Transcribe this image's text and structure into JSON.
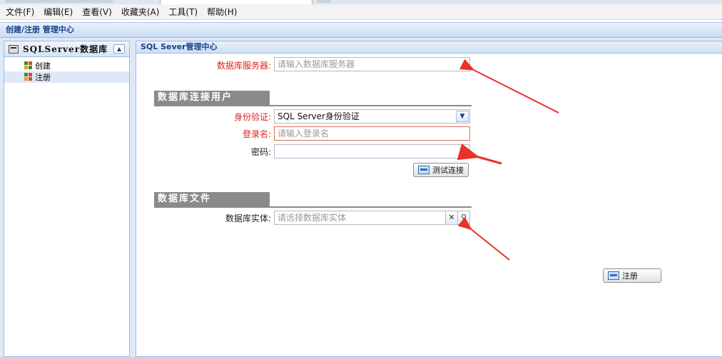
{
  "menu": [
    "文件(F)",
    "编辑(E)",
    "查看(V)",
    "收藏夹(A)",
    "工具(T)",
    "帮助(H)"
  ],
  "page_title": "创建/注册 管理中心",
  "sidebar": {
    "title": "SQLServer数据库",
    "items": [
      {
        "label": "创建",
        "selected": false
      },
      {
        "label": "注册",
        "selected": true
      }
    ]
  },
  "main": {
    "header": "SQL Sever管理中心",
    "server": {
      "label": "数据库服务器:",
      "placeholder": "请输入数据库服务器"
    },
    "section_user": "数据库连接用户",
    "auth": {
      "label": "身份验证:",
      "value": "SQL Server身份验证"
    },
    "login": {
      "label": "登录名:",
      "placeholder": "请输入登录名"
    },
    "password": {
      "label": "密码:",
      "value": ""
    },
    "test_button": "测试连接",
    "section_file": "数据库文件",
    "entity": {
      "label": "数据库实体:",
      "placeholder": "请选择数据库实体"
    },
    "register_button": "注册"
  },
  "colors": {
    "required_label": "#e02020",
    "header_text": "#15428b",
    "section_bg": "#8a8a8a",
    "annotation_arrow": "#e8332a"
  }
}
